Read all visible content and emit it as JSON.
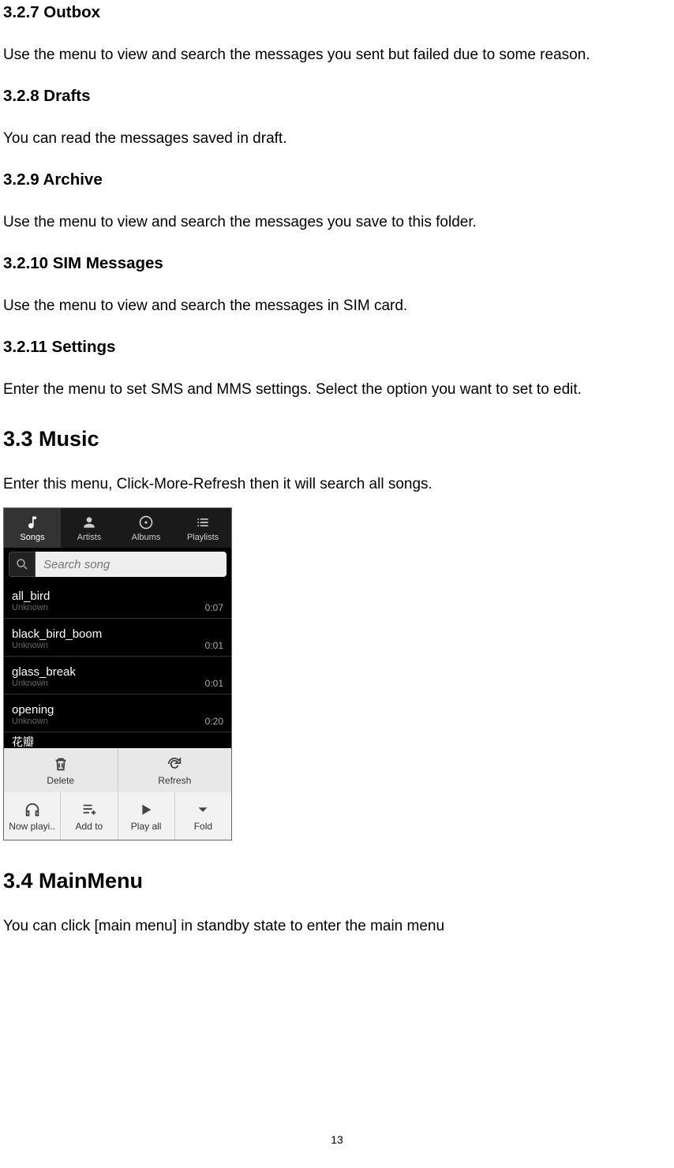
{
  "sections": {
    "outbox": {
      "heading": "3.2.7 Outbox",
      "body": "Use the menu to view and search the messages you sent but failed due to some reason."
    },
    "drafts": {
      "heading": "3.2.8 Drafts",
      "body": "You can read the messages saved in draft."
    },
    "archive": {
      "heading": "3.2.9 Archive",
      "body": "Use the menu to view and search the messages you save to this folder."
    },
    "sim": {
      "heading": "3.2.10 SIM Messages",
      "body": "Use the menu to view and search the messages in SIM card."
    },
    "settings": {
      "heading": "3.2.11 Settings",
      "body": "Enter the menu to set SMS and MMS settings. Select the option you want to set to edit."
    },
    "music": {
      "heading": "3.3 Music",
      "body": "Enter this menu, Click-More-Refresh then it will search all songs."
    },
    "mainmenu": {
      "heading": "3.4 MainMenu",
      "body": "You can click [main menu] in standby state to enter the main menu"
    }
  },
  "music_app": {
    "tabs": {
      "songs": "Songs",
      "artists": "Artists",
      "albums": "Albums",
      "playlists": "Playlists"
    },
    "search_placeholder": "Search song",
    "songs": [
      {
        "title": "all_bird",
        "artist": "Unknown",
        "duration": "0:07"
      },
      {
        "title": "black_bird_boom",
        "artist": "Unknown",
        "duration": "0:01"
      },
      {
        "title": "glass_break",
        "artist": "Unknown",
        "duration": "0:01"
      },
      {
        "title": "opening",
        "artist": "Unknown",
        "duration": "0:20"
      }
    ],
    "partial_song": "花瓣",
    "menu1": {
      "delete": "Delete",
      "refresh": "Refresh"
    },
    "menu2": {
      "nowplaying": "Now playi..",
      "addto": "Add to",
      "playall": "Play all",
      "fold": "Fold"
    }
  },
  "page_number": "13"
}
